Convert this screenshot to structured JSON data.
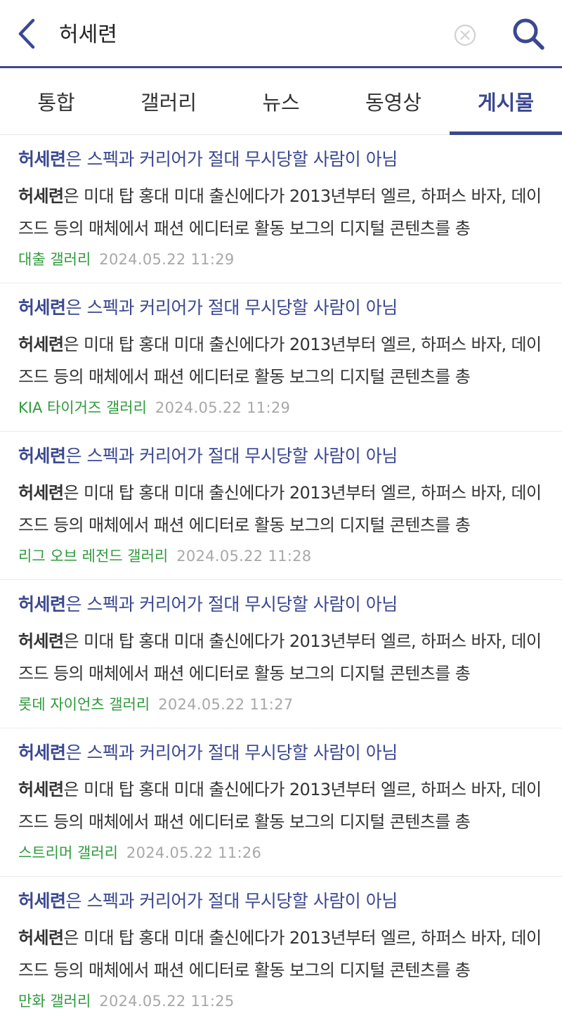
{
  "header": {
    "query": "허세련",
    "back_icon": "chevron-left-icon",
    "clear_icon": "clear-circle-icon",
    "search_icon": "search-icon",
    "accent_color": "#3b4890"
  },
  "tabs": [
    {
      "label": "통합",
      "active": false
    },
    {
      "label": "갤러리",
      "active": false
    },
    {
      "label": "뉴스",
      "active": false
    },
    {
      "label": "동영상",
      "active": false
    },
    {
      "label": "게시물",
      "active": true
    }
  ],
  "results": [
    {
      "title_keyword": "허세련",
      "title_rest": "은 스펙과 커리어가 절대 무시당할 사람이 아님",
      "snippet_keyword": "허세련",
      "snippet_rest": "은 미대 탑 홍대 미대 출신에다가 2013년부터 엘르, 하퍼스 바자, 데이즈드 등의 매체에서 패션 에디터로 활동 보그의 디지털 콘텐츠를 총",
      "gallery": "대출 갤러리",
      "date": "2024.05.22 11:29"
    },
    {
      "title_keyword": "허세련",
      "title_rest": "은 스펙과 커리어가 절대 무시당할 사람이 아님",
      "snippet_keyword": "허세련",
      "snippet_rest": "은 미대 탑 홍대 미대 출신에다가 2013년부터 엘르, 하퍼스 바자, 데이즈드 등의 매체에서 패션 에디터로 활동 보그의 디지털 콘텐츠를 총",
      "gallery": "KIA 타이거즈 갤러리",
      "date": "2024.05.22 11:29"
    },
    {
      "title_keyword": "허세련",
      "title_rest": "은 스펙과 커리어가 절대 무시당할 사람이 아님",
      "snippet_keyword": "허세련",
      "snippet_rest": "은 미대 탑 홍대 미대 출신에다가 2013년부터 엘르, 하퍼스 바자, 데이즈드 등의 매체에서 패션 에디터로 활동 보그의 디지털 콘텐츠를 총",
      "gallery": "리그 오브 레전드 갤러리",
      "date": "2024.05.22 11:28"
    },
    {
      "title_keyword": "허세련",
      "title_rest": "은 스펙과 커리어가 절대 무시당할 사람이 아님",
      "snippet_keyword": "허세련",
      "snippet_rest": "은 미대 탑 홍대 미대 출신에다가 2013년부터 엘르, 하퍼스 바자, 데이즈드 등의 매체에서 패션 에디터로 활동 보그의 디지털 콘텐츠를 총",
      "gallery": "롯데 자이언츠 갤러리",
      "date": "2024.05.22 11:27"
    },
    {
      "title_keyword": "허세련",
      "title_rest": "은 스펙과 커리어가 절대 무시당할 사람이 아님",
      "snippet_keyword": "허세련",
      "snippet_rest": "은 미대 탑 홍대 미대 출신에다가 2013년부터 엘르, 하퍼스 바자, 데이즈드 등의 매체에서 패션 에디터로 활동 보그의 디지털 콘텐츠를 총",
      "gallery": "스트리머 갤러리",
      "date": "2024.05.22 11:26"
    },
    {
      "title_keyword": "허세련",
      "title_rest": "은 스펙과 커리어가 절대 무시당할 사람이 아님",
      "snippet_keyword": "허세련",
      "snippet_rest": "은 미대 탑 홍대 미대 출신에다가 2013년부터 엘르, 하퍼스 바자, 데이즈드 등의 매체에서 패션 에디터로 활동 보그의 디지털 콘텐츠를 총",
      "gallery": "만화 갤러리",
      "date": "2024.05.22 11:25"
    }
  ]
}
